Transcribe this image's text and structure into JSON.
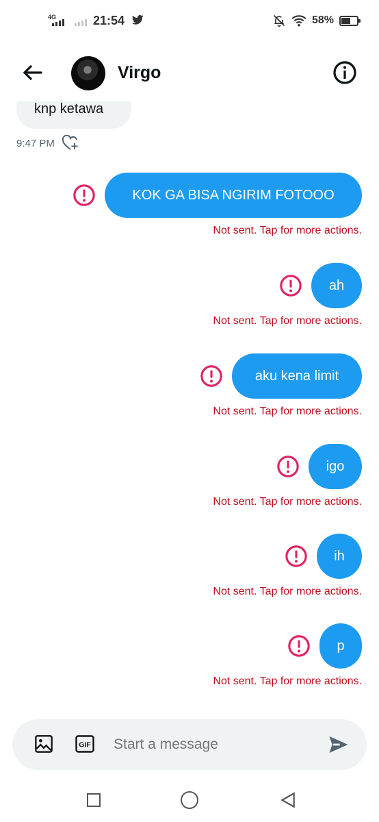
{
  "status_bar": {
    "network": "4G",
    "time": "21:54",
    "battery": "58%",
    "icons": [
      "signal-icon",
      "twitter-icon",
      "mute-bell-icon",
      "wifi-icon",
      "battery-icon"
    ]
  },
  "header": {
    "contact_name": "Virgo",
    "icons": [
      "back-arrow-icon",
      "avatar",
      "info-icon"
    ]
  },
  "incoming": {
    "text": "knp ketawa",
    "time": "9:47 PM",
    "react_icon": "heart-plus-icon"
  },
  "outgoing": [
    {
      "text": "KOK GA BISA NGIRIM FOTOOO",
      "error": "Not sent. Tap for more actions."
    },
    {
      "text": "ah",
      "error": "Not sent. Tap for more actions."
    },
    {
      "text": "aku kena limit",
      "error": "Not sent. Tap for more actions."
    },
    {
      "text": "igo",
      "error": "Not sent. Tap for more actions."
    },
    {
      "text": "ih",
      "error": "Not sent. Tap for more actions."
    },
    {
      "text": "p",
      "error": "Not sent. Tap for more actions."
    }
  ],
  "composer": {
    "placeholder": "Start a message",
    "gif_label": "GIF",
    "icons": [
      "image-icon",
      "gif-icon",
      "send-icon"
    ]
  },
  "colors": {
    "accent": "#1d9bf0",
    "error": "#c00d1c",
    "error_icon": "#e0245e",
    "bubble_in": "#eff3f4"
  }
}
